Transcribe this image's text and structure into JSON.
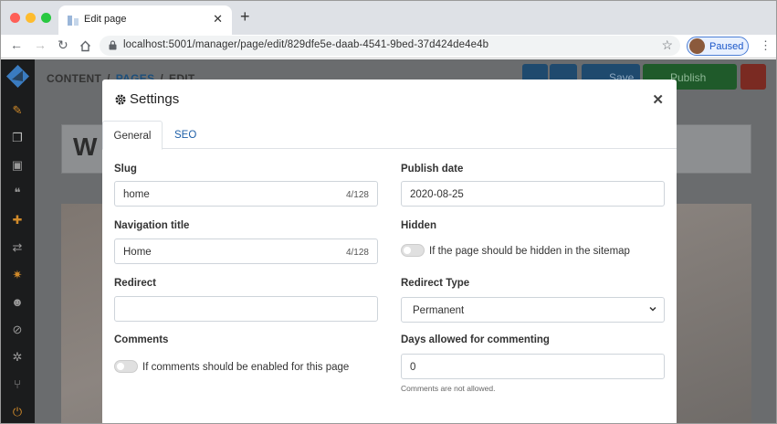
{
  "browser": {
    "tab_title": "Edit page",
    "url": "localhost:5001/manager/page/edit/829dfe5e-daab-4541-9bed-37d424de4e4b",
    "profile_label": "Paused"
  },
  "app": {
    "breadcrumb": [
      "CONTENT",
      "/",
      "PAGES",
      "/",
      "EDIT"
    ],
    "toolbar": {
      "save_label": "Save",
      "publish_label": "Publish"
    },
    "page_title_partial": "W"
  },
  "modal": {
    "title": "Settings",
    "tabs": [
      {
        "label": "General",
        "active": true
      },
      {
        "label": "SEO",
        "active": false
      }
    ],
    "fields": {
      "slug": {
        "label": "Slug",
        "value": "home",
        "count": "4/128"
      },
      "publish_date": {
        "label": "Publish date",
        "value": "2020-08-25"
      },
      "nav_title": {
        "label": "Navigation title",
        "value": "Home",
        "count": "4/128"
      },
      "hidden": {
        "label": "Hidden",
        "toggle_label": "If the page should be hidden in the sitemap",
        "checked": false
      },
      "redirect": {
        "label": "Redirect",
        "value": ""
      },
      "redirect_type": {
        "label": "Redirect Type",
        "value": "Permanent"
      },
      "comments": {
        "label": "Comments",
        "toggle_label": "If comments should be enabled for this page",
        "checked": false
      },
      "days_commenting": {
        "label": "Days allowed for commenting",
        "value": "0",
        "help": "Comments are not allowed."
      }
    }
  },
  "colors": {
    "save": "#2f5f8a",
    "publish": "#2e8a3c",
    "delete": "#c0392b",
    "link": "#1e5fa8"
  }
}
